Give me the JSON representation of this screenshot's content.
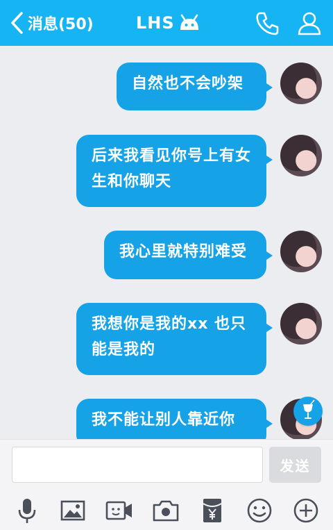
{
  "header": {
    "back_label": "消息(50)",
    "title": "LHS",
    "icons": [
      "back-chevron-icon",
      "android-icon",
      "phone-icon",
      "profile-icon"
    ]
  },
  "messages": [
    {
      "text": "自然也不会吵架"
    },
    {
      "text": "后来我看见你号上有女生和你聊天"
    },
    {
      "text": "我心里就特别难受"
    },
    {
      "text": "我想你是我的xx 也只能是我的"
    },
    {
      "text": "我不能让别人靠近你"
    }
  ],
  "input": {
    "placeholder": "",
    "send_label": "发送"
  },
  "toolbar": [
    "microphone-icon",
    "image-icon",
    "video-icon",
    "camera-icon",
    "red-packet-icon",
    "emoji-icon",
    "plus-icon"
  ],
  "colors": {
    "header": "#16b4f3",
    "bubble": "#16a2e6",
    "background": "#ebedf1"
  }
}
